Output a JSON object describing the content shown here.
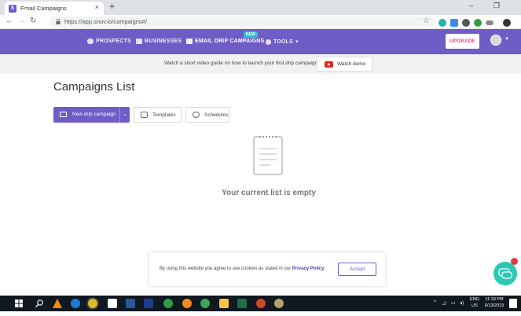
{
  "browser": {
    "tab_title": "Email Campaigns",
    "tab_close": "×",
    "new_tab": "+",
    "url": "https://app.snov.io/campaigns#/",
    "win_minimize": "–",
    "win_restore": "❐"
  },
  "app": {
    "logo": "Snov",
    "logo_suffix": "io",
    "nav": {
      "prospects": "PROSPECTS",
      "businesses": "BUSINESSES",
      "email_drip": "EMAIL DRIP CAMPAIGNS",
      "email_drip_badge": "NEW",
      "tools": "TOOLS"
    },
    "upgrade": "UPGRADE",
    "accent": "#6f5cc7"
  },
  "info": {
    "text": "Watch a short video guide on how to launch your first drip campaign",
    "watch_demo": "Watch demo"
  },
  "main": {
    "title": "Campaigns List",
    "new_campaign": "New drip campaign",
    "templates": "Templates",
    "schedules": "Schedules",
    "empty": "Your current list is empty"
  },
  "cookie": {
    "text": "By using this website you agree to use cookies as stated in our ",
    "policy": "Privacy Policy",
    "period": ".",
    "accept": "Accept"
  },
  "taskbar": {
    "lang": "ENG",
    "region": "US",
    "time": "11:18 PM",
    "date": "6/13/2019"
  }
}
